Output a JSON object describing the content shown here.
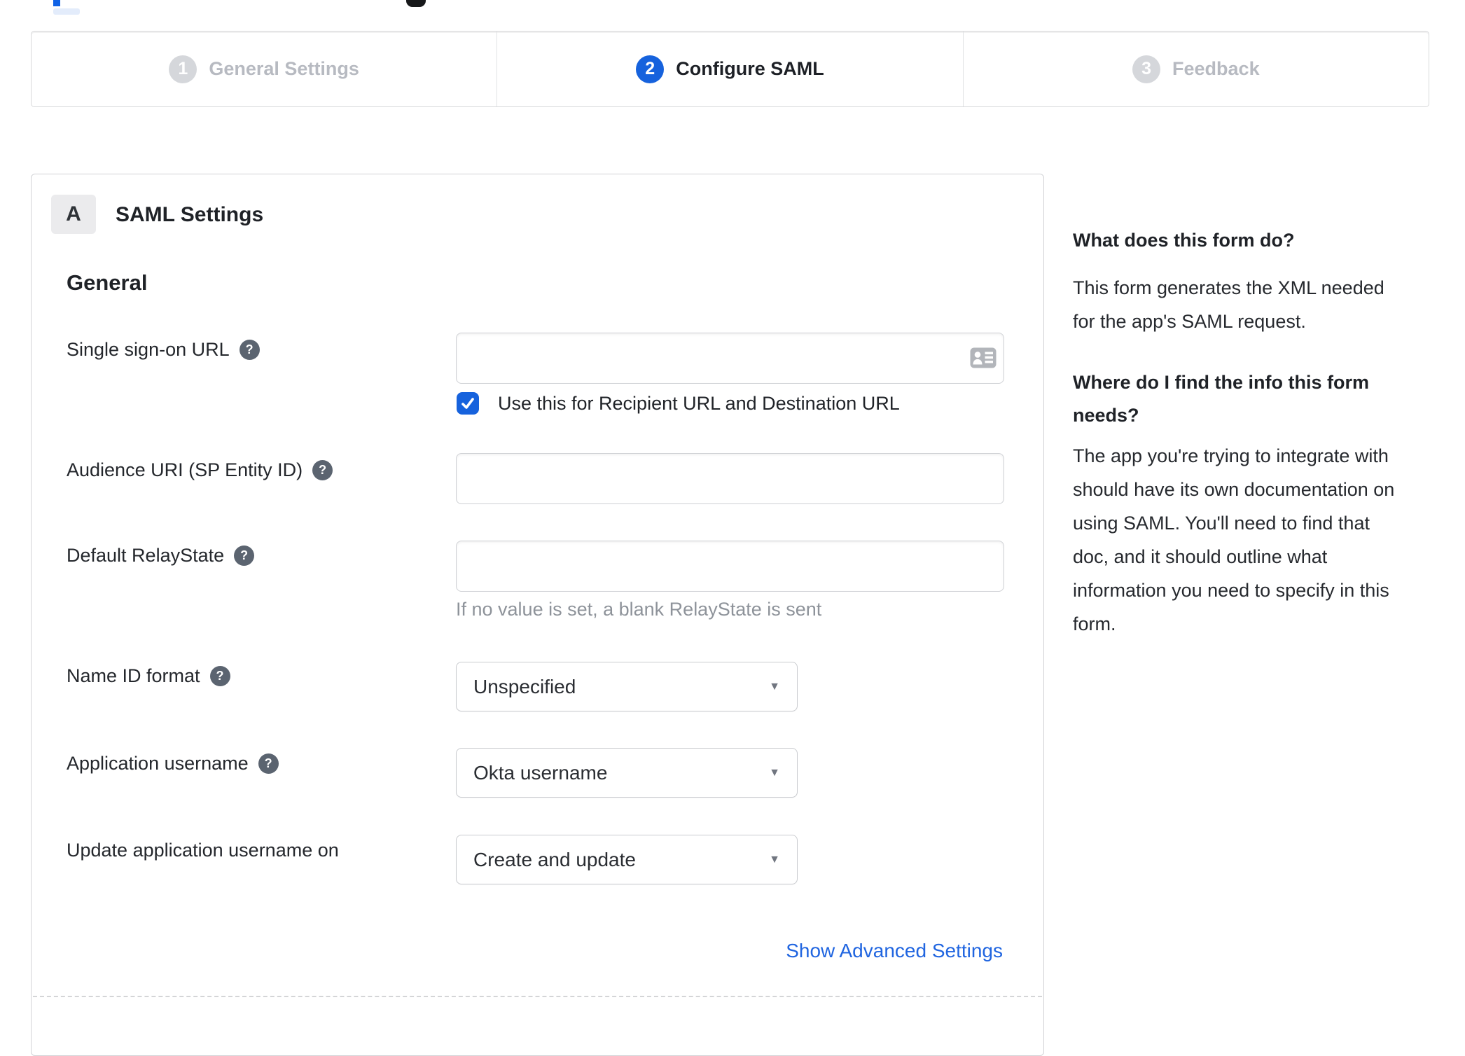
{
  "icons": {
    "help": "?",
    "dropdown": "▼"
  },
  "colors": {
    "accent_blue": "#1662dd",
    "link_blue": "#2065e0",
    "inactive_step_gray": "#d5d7db",
    "help_icon_gray": "#5b6470"
  },
  "stepper": {
    "steps": [
      {
        "number": "1",
        "label": "General Settings",
        "active": false
      },
      {
        "number": "2",
        "label": "Configure SAML",
        "active": true
      },
      {
        "number": "3",
        "label": "Feedback",
        "active": false
      }
    ]
  },
  "form": {
    "section_badge": "A",
    "section_title": "SAML Settings",
    "group_title": "General",
    "sso": {
      "label": "Single sign-on URL",
      "value": "",
      "checkbox_label": "Use this for Recipient URL and Destination URL",
      "checked": true
    },
    "audience": {
      "label": "Audience URI (SP Entity ID)",
      "value": ""
    },
    "relay": {
      "label": "Default RelayState",
      "value": "",
      "helper": "If no value is set, a blank RelayState is sent"
    },
    "nameid": {
      "label": "Name ID format",
      "value": "Unspecified"
    },
    "appuser": {
      "label": "Application username",
      "value": "Okta username"
    },
    "updateuser": {
      "label": "Update application username on",
      "value": "Create and update"
    },
    "advanced_link": "Show Advanced Settings"
  },
  "help_panel": {
    "q1_title": "What does this form do?",
    "q1_body": "This form generates the XML needed\nfor the app's SAML request.",
    "q2_title": "Where do I find the info this form\nneeds?",
    "q2_body": "The app you're trying to integrate with\nshould have its own documentation on\nusing SAML. You'll need to find that\ndoc, and it should outline what\ninformation you need to specify in this\nform."
  }
}
